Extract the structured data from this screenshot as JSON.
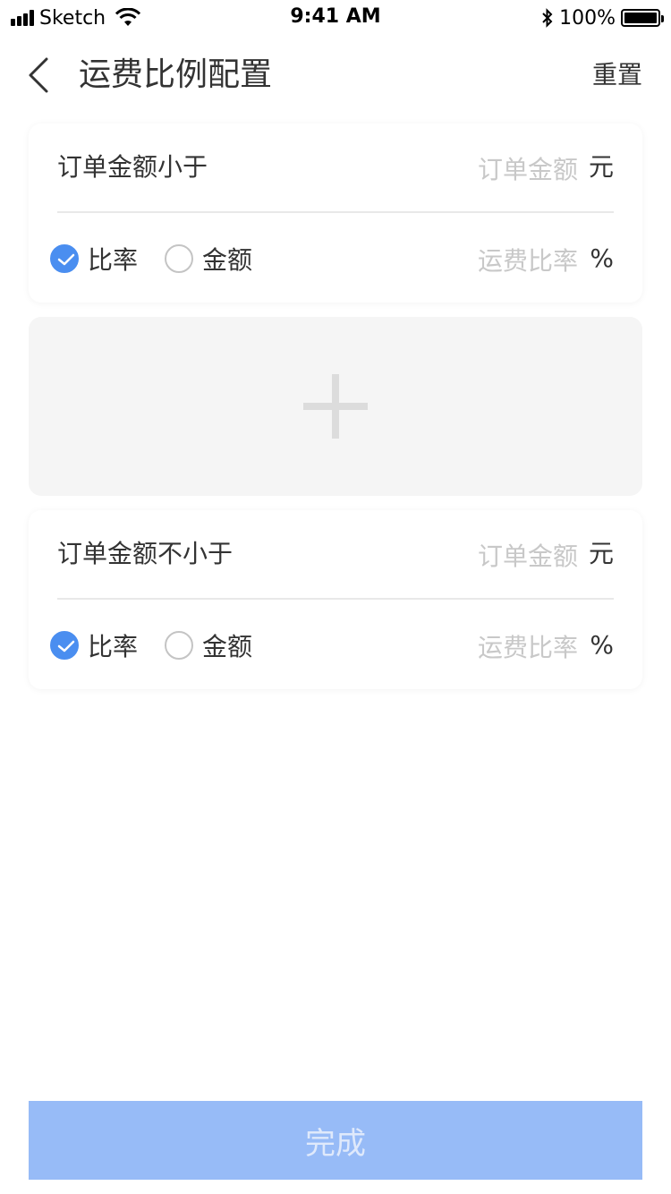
{
  "status_bar": {
    "carrier": "Sketch",
    "time": "9:41 AM",
    "battery": "100%"
  },
  "nav": {
    "title": "运费比例配置",
    "reset_label": "重置",
    "back_icon": "chevron-left-icon"
  },
  "rules": [
    {
      "condition_label": "订单金额小于",
      "amount_placeholder": "订单金额",
      "amount_value": "",
      "amount_unit": "元",
      "options": [
        {
          "label": "比率",
          "checked": true
        },
        {
          "label": "金额",
          "checked": false
        }
      ],
      "fee_placeholder": "运费比率",
      "fee_value": "",
      "fee_unit": "%"
    },
    {
      "condition_label": "订单金额不小于",
      "amount_placeholder": "订单金额",
      "amount_value": "",
      "amount_unit": "元",
      "options": [
        {
          "label": "比率",
          "checked": true
        },
        {
          "label": "金额",
          "checked": false
        }
      ],
      "fee_placeholder": "运费比率",
      "fee_value": "",
      "fee_unit": "%"
    }
  ],
  "add_rule": {
    "icon": "plus-icon"
  },
  "footer": {
    "done_label": "完成"
  },
  "colors": {
    "accent": "#4a8ef0",
    "done_button_bg": "#97bbf7",
    "add_block_bg": "#f5f5f5",
    "placeholder": "#c8c8c8"
  }
}
